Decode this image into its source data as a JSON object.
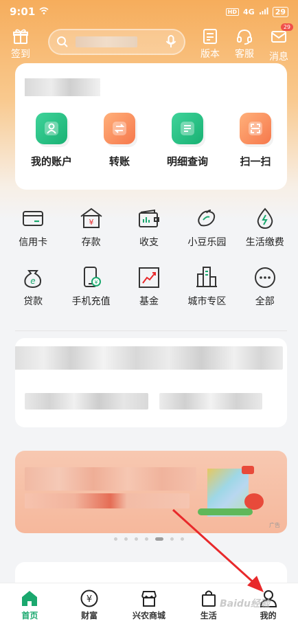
{
  "status_bar": {
    "time": "9:01",
    "network": "4G",
    "battery": "29"
  },
  "header": {
    "sign_in": "签到",
    "version": "版本",
    "service": "客服",
    "messages": "消息",
    "message_badge": "29"
  },
  "quick_actions": [
    {
      "label": "我的账户",
      "icon": "account-icon",
      "color": "#1fb87a"
    },
    {
      "label": "转账",
      "icon": "transfer-icon",
      "color": "#f6784c"
    },
    {
      "label": "明细查询",
      "icon": "details-icon",
      "color": "#1fb87a"
    },
    {
      "label": "扫一扫",
      "icon": "scan-icon",
      "color": "#f6784c"
    }
  ],
  "services_row1": [
    {
      "label": "信用卡",
      "icon": "credit-card-icon"
    },
    {
      "label": "存款",
      "icon": "deposit-icon"
    },
    {
      "label": "收支",
      "icon": "wallet-icon"
    },
    {
      "label": "小豆乐园",
      "icon": "bean-icon"
    },
    {
      "label": "生活缴费",
      "icon": "utility-icon"
    }
  ],
  "services_row2": [
    {
      "label": "贷款",
      "icon": "loan-icon"
    },
    {
      "label": "手机充值",
      "icon": "phone-topup-icon"
    },
    {
      "label": "基金",
      "icon": "fund-icon"
    },
    {
      "label": "城市专区",
      "icon": "city-icon"
    },
    {
      "label": "全部",
      "icon": "more-icon"
    }
  ],
  "banner": {
    "ad_label": "广告"
  },
  "tabbar": [
    {
      "label": "首页",
      "icon": "home-icon",
      "active": true
    },
    {
      "label": "财富",
      "icon": "wealth-icon",
      "active": false
    },
    {
      "label": "兴农商城",
      "icon": "mall-icon",
      "active": false
    },
    {
      "label": "生活",
      "icon": "life-icon",
      "active": false
    },
    {
      "label": "我的",
      "icon": "profile-icon",
      "active": false
    }
  ],
  "watermark": "Baidu经验",
  "colors": {
    "accent": "#1aa86e",
    "header": "#f6ad5c",
    "arrow": "#e8292b"
  }
}
